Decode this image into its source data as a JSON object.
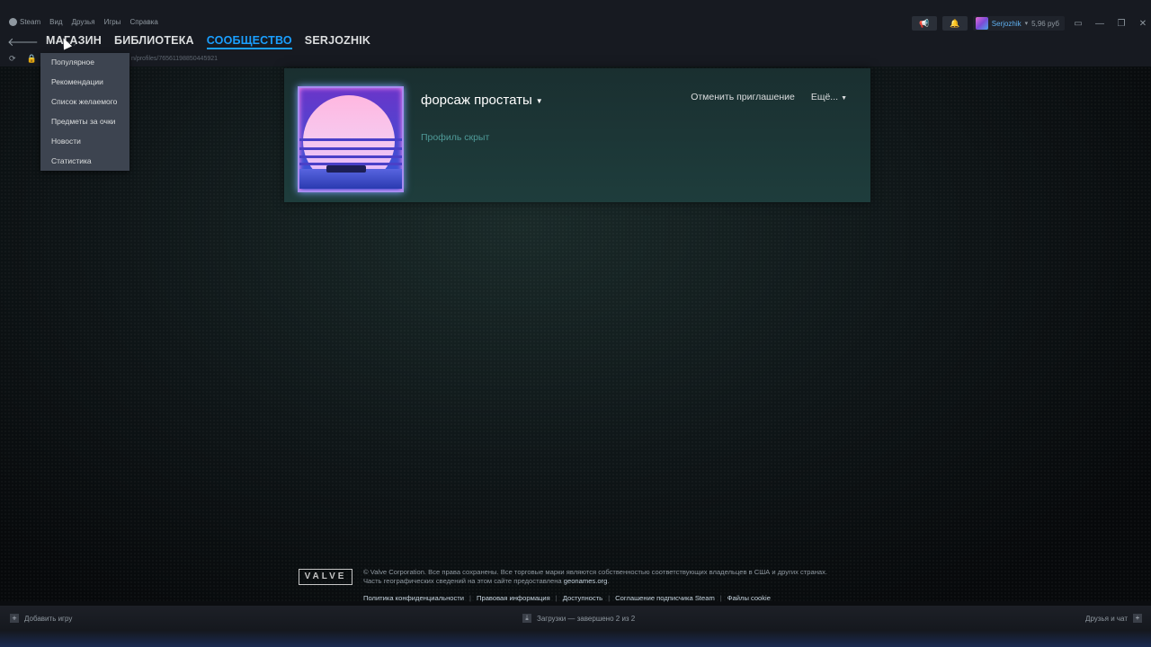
{
  "menubar": {
    "items": [
      "Steam",
      "Вид",
      "Друзья",
      "Игры",
      "Справка"
    ]
  },
  "topright": {
    "broadcast_icon": "megaphone-icon",
    "notifications_icon": "bell-icon",
    "username": "Serjozhik",
    "balance": "5,96 руб",
    "bigpicture_icon": "monitor-icon"
  },
  "nav": {
    "links": [
      "МАГАЗИН",
      "БИБЛИОТЕКА",
      "СООБЩЕСТВО",
      "SERJOZHIK"
    ],
    "active": "СООБЩЕСТВО"
  },
  "url": {
    "text": "n/profiles/76561198850445921"
  },
  "store_menu": {
    "items": [
      "Популярное",
      "Рекомендации",
      "Список желаемого",
      "Предметы за очки",
      "Новости",
      "Статистика"
    ]
  },
  "profile": {
    "name": "форсаж простаты",
    "status": "Профиль скрыт",
    "cancel_invite": "Отменить приглашение",
    "more": "Ещё..."
  },
  "footer": {
    "logo": "VALVE",
    "line1": "© Valve Corporation. Все права сохранены. Все торговые марки являются собственностью соответствующих владельцев в США и других странах.",
    "line2_prefix": "Часть географических сведений на этом сайте предоставлена ",
    "line2_link": "geonames.org",
    "links": [
      "Политика конфиденциальности",
      "Правовая информация",
      "Доступность",
      "Соглашение подписчика Steam",
      "Файлы cookie"
    ]
  },
  "bottombar": {
    "add_game": "Добавить игру",
    "downloads": "Загрузки — завершено 2 из 2",
    "friends": "Друзья и чат"
  }
}
